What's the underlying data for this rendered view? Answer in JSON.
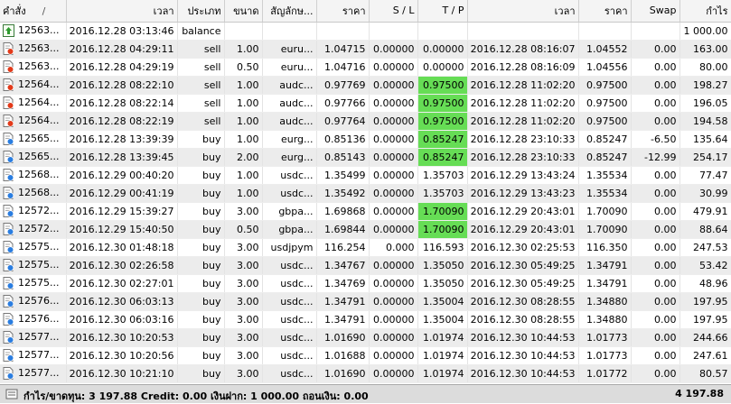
{
  "columns": {
    "ticket": "คำสั่ง",
    "sort_marker": "/",
    "open_time": "เวลา",
    "type": "ประเภท",
    "size": "ขนาด",
    "symbol": "สัญลักษ...",
    "open_price": "ราคา",
    "sl": "S / L",
    "tp": "T / P",
    "close_time": "เวลา",
    "close_price": "ราคา",
    "swap": "Swap",
    "profit": "กำไร"
  },
  "colors": {
    "tp_highlight": "#66dd55",
    "row_alt": "#ececec",
    "summary_bg": "#dcdcdc"
  },
  "rows": [
    {
      "icon": "balance-icon",
      "ticket": "12563...",
      "open_time": "2016.12.28 03:13:46",
      "type": "balance",
      "size": "",
      "symbol": "",
      "open_price": "",
      "sl": "",
      "tp": "",
      "close_time": "",
      "close_price": "",
      "swap": "",
      "profit": "1 000.00",
      "tp_hit": false
    },
    {
      "icon": "sell-order-icon",
      "ticket": "12563...",
      "open_time": "2016.12.28 04:29:11",
      "type": "sell",
      "size": "1.00",
      "symbol": "euru...",
      "open_price": "1.04715",
      "sl": "0.00000",
      "tp": "0.00000",
      "close_time": "2016.12.28 08:16:07",
      "close_price": "1.04552",
      "swap": "0.00",
      "profit": "163.00",
      "tp_hit": false
    },
    {
      "icon": "sell-order-icon",
      "ticket": "12563...",
      "open_time": "2016.12.28 04:29:19",
      "type": "sell",
      "size": "0.50",
      "symbol": "euru...",
      "open_price": "1.04716",
      "sl": "0.00000",
      "tp": "0.00000",
      "close_time": "2016.12.28 08:16:09",
      "close_price": "1.04556",
      "swap": "0.00",
      "profit": "80.00",
      "tp_hit": false
    },
    {
      "icon": "sell-order-icon",
      "ticket": "12564...",
      "open_time": "2016.12.28 08:22:10",
      "type": "sell",
      "size": "1.00",
      "symbol": "audc...",
      "open_price": "0.97769",
      "sl": "0.00000",
      "tp": "0.97500",
      "close_time": "2016.12.28 11:02:20",
      "close_price": "0.97500",
      "swap": "0.00",
      "profit": "198.27",
      "tp_hit": true
    },
    {
      "icon": "sell-order-icon",
      "ticket": "12564...",
      "open_time": "2016.12.28 08:22:14",
      "type": "sell",
      "size": "1.00",
      "symbol": "audc...",
      "open_price": "0.97766",
      "sl": "0.00000",
      "tp": "0.97500",
      "close_time": "2016.12.28 11:02:20",
      "close_price": "0.97500",
      "swap": "0.00",
      "profit": "196.05",
      "tp_hit": true
    },
    {
      "icon": "sell-order-icon",
      "ticket": "12564...",
      "open_time": "2016.12.28 08:22:19",
      "type": "sell",
      "size": "1.00",
      "symbol": "audc...",
      "open_price": "0.97764",
      "sl": "0.00000",
      "tp": "0.97500",
      "close_time": "2016.12.28 11:02:20",
      "close_price": "0.97500",
      "swap": "0.00",
      "profit": "194.58",
      "tp_hit": true
    },
    {
      "icon": "buy-order-icon",
      "ticket": "12565...",
      "open_time": "2016.12.28 13:39:39",
      "type": "buy",
      "size": "1.00",
      "symbol": "eurg...",
      "open_price": "0.85136",
      "sl": "0.00000",
      "tp": "0.85247",
      "close_time": "2016.12.28 23:10:33",
      "close_price": "0.85247",
      "swap": "-6.50",
      "profit": "135.64",
      "tp_hit": true
    },
    {
      "icon": "buy-order-icon",
      "ticket": "12565...",
      "open_time": "2016.12.28 13:39:45",
      "type": "buy",
      "size": "2.00",
      "symbol": "eurg...",
      "open_price": "0.85143",
      "sl": "0.00000",
      "tp": "0.85247",
      "close_time": "2016.12.28 23:10:33",
      "close_price": "0.85247",
      "swap": "-12.99",
      "profit": "254.17",
      "tp_hit": true
    },
    {
      "icon": "buy-order-icon",
      "ticket": "12568...",
      "open_time": "2016.12.29 00:40:20",
      "type": "buy",
      "size": "1.00",
      "symbol": "usdc...",
      "open_price": "1.35499",
      "sl": "0.00000",
      "tp": "1.35703",
      "close_time": "2016.12.29 13:43:24",
      "close_price": "1.35534",
      "swap": "0.00",
      "profit": "77.47",
      "tp_hit": false
    },
    {
      "icon": "buy-order-icon",
      "ticket": "12568...",
      "open_time": "2016.12.29 00:41:19",
      "type": "buy",
      "size": "1.00",
      "symbol": "usdc...",
      "open_price": "1.35492",
      "sl": "0.00000",
      "tp": "1.35703",
      "close_time": "2016.12.29 13:43:23",
      "close_price": "1.35534",
      "swap": "0.00",
      "profit": "30.99",
      "tp_hit": false
    },
    {
      "icon": "buy-order-icon",
      "ticket": "12572...",
      "open_time": "2016.12.29 15:39:27",
      "type": "buy",
      "size": "3.00",
      "symbol": "gbpa...",
      "open_price": "1.69868",
      "sl": "0.00000",
      "tp": "1.70090",
      "close_time": "2016.12.29 20:43:01",
      "close_price": "1.70090",
      "swap": "0.00",
      "profit": "479.91",
      "tp_hit": true
    },
    {
      "icon": "buy-order-icon",
      "ticket": "12572...",
      "open_time": "2016.12.29 15:40:50",
      "type": "buy",
      "size": "0.50",
      "symbol": "gbpa...",
      "open_price": "1.69844",
      "sl": "0.00000",
      "tp": "1.70090",
      "close_time": "2016.12.29 20:43:01",
      "close_price": "1.70090",
      "swap": "0.00",
      "profit": "88.64",
      "tp_hit": true
    },
    {
      "icon": "buy-order-icon",
      "ticket": "12575...",
      "open_time": "2016.12.30 01:48:18",
      "type": "buy",
      "size": "3.00",
      "symbol": "usdjpym",
      "open_price": "116.254",
      "sl": "0.000",
      "tp": "116.593",
      "close_time": "2016.12.30 02:25:53",
      "close_price": "116.350",
      "swap": "0.00",
      "profit": "247.53",
      "tp_hit": false
    },
    {
      "icon": "buy-order-icon",
      "ticket": "12575...",
      "open_time": "2016.12.30 02:26:58",
      "type": "buy",
      "size": "3.00",
      "symbol": "usdc...",
      "open_price": "1.34767",
      "sl": "0.00000",
      "tp": "1.35050",
      "close_time": "2016.12.30 05:49:25",
      "close_price": "1.34791",
      "swap": "0.00",
      "profit": "53.42",
      "tp_hit": false
    },
    {
      "icon": "buy-order-icon",
      "ticket": "12575...",
      "open_time": "2016.12.30 02:27:01",
      "type": "buy",
      "size": "3.00",
      "symbol": "usdc...",
      "open_price": "1.34769",
      "sl": "0.00000",
      "tp": "1.35050",
      "close_time": "2016.12.30 05:49:25",
      "close_price": "1.34791",
      "swap": "0.00",
      "profit": "48.96",
      "tp_hit": false
    },
    {
      "icon": "buy-order-icon",
      "ticket": "12576...",
      "open_time": "2016.12.30 06:03:13",
      "type": "buy",
      "size": "3.00",
      "symbol": "usdc...",
      "open_price": "1.34791",
      "sl": "0.00000",
      "tp": "1.35004",
      "close_time": "2016.12.30 08:28:55",
      "close_price": "1.34880",
      "swap": "0.00",
      "profit": "197.95",
      "tp_hit": false
    },
    {
      "icon": "buy-order-icon",
      "ticket": "12576...",
      "open_time": "2016.12.30 06:03:16",
      "type": "buy",
      "size": "3.00",
      "symbol": "usdc...",
      "open_price": "1.34791",
      "sl": "0.00000",
      "tp": "1.35004",
      "close_time": "2016.12.30 08:28:55",
      "close_price": "1.34880",
      "swap": "0.00",
      "profit": "197.95",
      "tp_hit": false
    },
    {
      "icon": "buy-order-icon",
      "ticket": "12577...",
      "open_time": "2016.12.30 10:20:53",
      "type": "buy",
      "size": "3.00",
      "symbol": "usdc...",
      "open_price": "1.01690",
      "sl": "0.00000",
      "tp": "1.01974",
      "close_time": "2016.12.30 10:44:53",
      "close_price": "1.01773",
      "swap": "0.00",
      "profit": "244.66",
      "tp_hit": false
    },
    {
      "icon": "buy-order-icon",
      "ticket": "12577...",
      "open_time": "2016.12.30 10:20:56",
      "type": "buy",
      "size": "3.00",
      "symbol": "usdc...",
      "open_price": "1.01688",
      "sl": "0.00000",
      "tp": "1.01974",
      "close_time": "2016.12.30 10:44:53",
      "close_price": "1.01773",
      "swap": "0.00",
      "profit": "247.61",
      "tp_hit": false
    },
    {
      "icon": "buy-order-icon",
      "ticket": "12577...",
      "open_time": "2016.12.30 10:21:10",
      "type": "buy",
      "size": "3.00",
      "symbol": "usdc...",
      "open_price": "1.01690",
      "sl": "0.00000",
      "tp": "1.01974",
      "close_time": "2016.12.30 10:44:53",
      "close_price": "1.01772",
      "swap": "0.00",
      "profit": "80.57",
      "tp_hit": false
    }
  ],
  "summary": {
    "text": "กำไร/ขาดทุน: 3 197.88  Credit: 0.00  เงินฝาก: 1 000.00  ถอนเงิน: 0.00",
    "total": "4 197.88"
  }
}
